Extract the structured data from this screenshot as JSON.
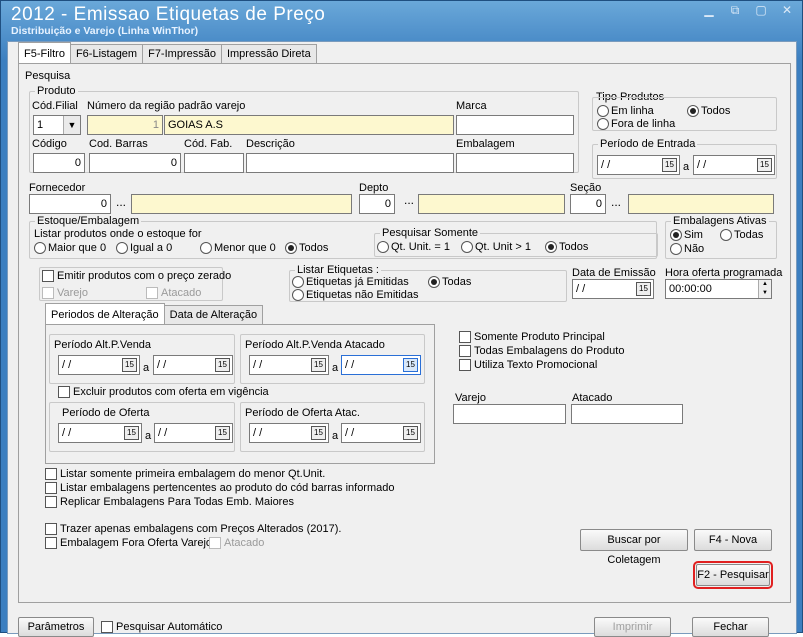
{
  "window": {
    "title": "2012 - Emissao Etiquetas de Preço",
    "subtitle": "Distribuição e Varejo (Linha WinThor)",
    "controls": [
      "▁",
      "⧉",
      "▢",
      "✕"
    ]
  },
  "tabs": [
    "F5-Filtro",
    "F6-Listagem",
    "F7-Impressão",
    "Impressão Direta"
  ],
  "pesquisa": {
    "title": "Pesquisa",
    "produto": {
      "title": "Produto",
      "cod_filial_label": "Cód.Filial",
      "cod_filial_value": "1",
      "regiao_label": "Número da região padrão varejo",
      "regiao_num": "1",
      "regiao_nome": "GOIAS A.S",
      "marca_label": "Marca",
      "codigo_label": "Código",
      "codigo_value": "0",
      "cod_barras_label": "Cod. Barras",
      "cod_barras_value": "0",
      "cod_fab_label": "Cód. Fab.",
      "descricao_label": "Descrição",
      "embalagem_label": "Embalagem"
    },
    "tipo_produtos": {
      "title": "Tipo Produtos",
      "em_linha": "Em linha",
      "todos": "Todos",
      "fora_linha": "Fora de linha"
    },
    "periodo_entrada": {
      "title": "Período de Entrada",
      "ini": "/ /",
      "a": "a",
      "fim": "/ /"
    },
    "fornecedor": {
      "label": "Fornecedor",
      "value": "0",
      "dots": "..."
    },
    "depto": {
      "label": "Depto",
      "value": "0",
      "dots": "..."
    },
    "secao": {
      "label": "Seção",
      "value": "0",
      "dots": "..."
    },
    "estoque": {
      "title": "Estoque/Embalagem",
      "listar_label": "Listar produtos onde o estoque for",
      "options": [
        "Maior que 0",
        "Igual a 0",
        "Menor que 0",
        "Todos"
      ]
    },
    "pesquisar_somente": {
      "title": "Pesquisar Somente",
      "options": [
        "Qt. Unit. = 1",
        "Qt. Unit  > 1",
        "Todos"
      ]
    },
    "embalagens_ativas": {
      "title": "Embalagens Ativas",
      "sim": "Sim",
      "todas": "Todas",
      "nao": "Não"
    },
    "preco_zerado": {
      "label": "Emitir produtos com o preço zerado",
      "varejo": "Varejo",
      "atacado": "Atacado"
    },
    "listar_etiquetas": {
      "title": "Listar Etiquetas :",
      "ja_emitidas": "Etiquetas já Emitidas",
      "todas": "Todas",
      "nao_emitidas": "Etiquetas não Emitidas"
    },
    "data_emissao": {
      "label": "Data de Emissão",
      "value": "/ /"
    },
    "hora_oferta": {
      "label": "Hora oferta programada",
      "value": "00:00:00"
    },
    "periodos_tabs": [
      "Periodos de Alteração",
      "Data de Alteração"
    ],
    "periodo_alt_varejo": {
      "title": "Período Alt.P.Venda",
      "ini": "/ /",
      "a": "a",
      "fim": "/ /"
    },
    "periodo_alt_atacado": {
      "title": "Período Alt.P.Venda Atacado",
      "ini": "/ /",
      "a": "a",
      "fim": "/ /"
    },
    "excluir_oferta": "Excluir produtos com oferta em vigência",
    "periodo_oferta": {
      "title": "Período de Oferta",
      "ini": "/ /",
      "a": "a",
      "fim": "/ /"
    },
    "periodo_oferta_atac": {
      "title": "Período de Oferta Atac.",
      "ini": "/ /",
      "a": "a",
      "fim": "/ /"
    },
    "right_checks": [
      "Somente Produto Principal",
      "Todas Embalagens do Produto",
      "Utiliza Texto Promocional"
    ],
    "varejo_label": "Varejo",
    "atacado_label": "Atacado",
    "bottom_checks": [
      "Listar somente primeira embalagem do menor Qt.Unit.",
      "Listar embalagens pertencentes ao produto do cód barras informado",
      "Replicar Embalagens Para Todas Emb. Maiores"
    ],
    "trazer_alterados": "Trazer apenas embalagens com Preços Alterados (2017).",
    "fora_oferta": "Embalagem Fora Oferta Varejo e",
    "fora_oferta_atacado": "Atacado"
  },
  "buttons": {
    "coletagem": "Buscar por Coletagem",
    "nova": "F4 - Nova",
    "pesquisar": "F2 - Pesquisar",
    "parametros": "Parâmetros",
    "pesquisar_auto": "Pesquisar Automático",
    "imprimir": "Imprimir",
    "fechar": "Fechar"
  },
  "calendar_icon": "15"
}
